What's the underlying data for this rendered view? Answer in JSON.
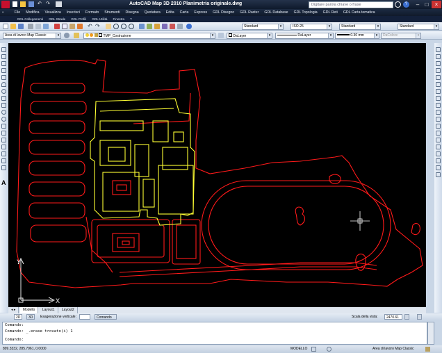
{
  "window": {
    "title": "AutoCAD Map 3D 2010    Planimetria originale.dwg",
    "search_placeholder": "Digitare parola chiave o frase"
  },
  "menu": [
    "File",
    "Modifica",
    "Visualizza",
    "Inserisci",
    "Formato",
    "Strumenti",
    "Disegna",
    "Quotatura",
    "Edita",
    "Carta",
    "Express",
    "GDL Disegno",
    "GDL Raster",
    "GDL Database",
    "GDL Topologia",
    "GDL Reti",
    "GDL Carta tematica"
  ],
  "menu2": [
    "GDL Collegamenti",
    "GDL Strade",
    "GDL Profili",
    "GDL Utilità",
    "Finestra",
    "?"
  ],
  "toolbar2": {
    "style1": "Standard",
    "dimscale": "ISO-25",
    "style2": "Standard",
    "style3": "Standard"
  },
  "toolbar3": {
    "workspace": "Area di lavoro Map Classic",
    "layer": "TMP_Costruzione",
    "color": "DaLayer",
    "linetype": "DaLayer",
    "lineweight": "0.30 mm",
    "plotstyle": "DaColore"
  },
  "tabs": [
    "Modello",
    "Layout1",
    "Layout2"
  ],
  "status": {
    "view2d": "2D",
    "view3d": "3D",
    "exag_label": "Esagerazione verticale:",
    "command_label": "Comando",
    "scale_label": "Scala della vista:",
    "scale_value": "2470.61"
  },
  "command": {
    "lines": [
      "Comando:",
      "Comando: _.erase trovato(i) 1",
      "Comando:"
    ]
  },
  "bottom": {
    "coords": "899.3332, 285.7961, 0.0000",
    "mode": "MODELLO",
    "workspace": "Area di lavoro Map Classic"
  },
  "ucs": {
    "x_label": "X",
    "y_label": "Y"
  },
  "colors": {
    "red_layer": "#ff1a1a",
    "yellow_layer": "#ffff33",
    "canvas": "#000000"
  }
}
